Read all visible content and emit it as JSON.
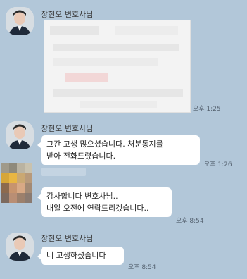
{
  "messages": [
    {
      "sender": "장현오 변호사님",
      "type": "image",
      "time": "오후 1:25"
    },
    {
      "sender": "장현오 변호사님",
      "type": "text",
      "lines": [
        "그간 고생 많으셨습니다. 처분통지를",
        "받아 전화드렸습니다."
      ],
      "time": "오후 1:26"
    },
    {
      "sender": "",
      "type": "text",
      "lines": [
        "감사합니다 변호사님..",
        "내일 오전에 연락드리겠습니다.."
      ],
      "time": "오후 8:54"
    },
    {
      "sender": "장현오 변호사님",
      "type": "text",
      "lines": [
        "네 고생하셨습니다"
      ],
      "time": "오후 8:54"
    }
  ],
  "colors": {
    "background": "#b2c7d9",
    "bubble": "#ffffff",
    "time_text": "#556270"
  },
  "icons": {
    "lawyer_avatar": "profile-photo",
    "client_avatar": "pixelated-profile-photo"
  }
}
